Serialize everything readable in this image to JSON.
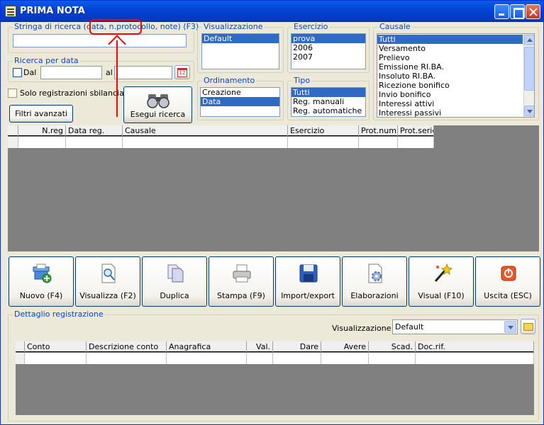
{
  "window": {
    "title": "PRIMA NOTA"
  },
  "search": {
    "legend": "Stringa di ricerca (data, n.protocollo, note) (F3)",
    "value": ""
  },
  "date_search": {
    "legend": "Ricerca per data",
    "from_label": "Dal",
    "to_label": "al",
    "from_value": "",
    "to_value": "",
    "calendar_day": "12"
  },
  "unbalanced_label": "Solo registrazioni sbilanciate",
  "advanced_filters_label": "Filtri avanzati",
  "run_search_label": "Esegui ricerca",
  "visualizzazione": {
    "legend": "Visualizzazione",
    "items": [
      {
        "label": "Default",
        "selected": true
      }
    ]
  },
  "esercizio": {
    "legend": "Esercizio",
    "items": [
      {
        "label": "prova",
        "selected": true
      },
      {
        "label": "2006",
        "selected": false
      },
      {
        "label": "2007",
        "selected": false
      }
    ]
  },
  "causale": {
    "legend": "Causale",
    "items": [
      {
        "label": "Tutti",
        "selected": true
      },
      {
        "label": "Versamento",
        "selected": false
      },
      {
        "label": "Prelievo",
        "selected": false
      },
      {
        "label": "Emissione RI.BA.",
        "selected": false
      },
      {
        "label": "Insoluto RI.BA.",
        "selected": false
      },
      {
        "label": "Ricezione bonifico",
        "selected": false
      },
      {
        "label": "Invio bonifico",
        "selected": false
      },
      {
        "label": "Interessi attivi",
        "selected": false
      },
      {
        "label": "Interessi passivi",
        "selected": false
      }
    ]
  },
  "ordinamento": {
    "legend": "Ordinamento",
    "items": [
      {
        "label": "Creazione",
        "selected": false
      },
      {
        "label": "Data",
        "selected": true
      }
    ]
  },
  "tipo": {
    "legend": "Tipo",
    "items": [
      {
        "label": "Tutti",
        "selected": true
      },
      {
        "label": "Reg. manuali",
        "selected": false
      },
      {
        "label": "Reg. automatiche",
        "selected": false
      }
    ]
  },
  "main_grid": {
    "columns": [
      "N.reg",
      "Data reg.",
      "Causale",
      "Esercizio",
      "Prot.num",
      "Prot.serie"
    ]
  },
  "actions": [
    {
      "label": "Nuovo (F4)",
      "icon": "new-document-icon"
    },
    {
      "label": "Visualizza (F2)",
      "icon": "view-document-icon"
    },
    {
      "label": "Duplica",
      "icon": "duplicate-icon"
    },
    {
      "label": "Stampa (F9)",
      "icon": "printer-icon"
    },
    {
      "label": "Import/export",
      "icon": "floppy-disk-icon"
    },
    {
      "label": "Elaborazioni",
      "icon": "process-gear-icon"
    },
    {
      "label": "Visual (F10)",
      "icon": "magic-wand-icon"
    },
    {
      "label": "Uscita (ESC)",
      "icon": "exit-icon"
    }
  ],
  "detail": {
    "legend": "Dettaglio registrazione",
    "view_label": "Visualizzazione :",
    "view_value": "Default",
    "columns": [
      "Conto",
      "Descrizione conto",
      "Anagrafica",
      "Val.",
      "Dare",
      "Avere",
      "Scad.",
      "Doc.rif."
    ]
  },
  "colors": {
    "title_bar": "#0542d6",
    "selection": "#316ac5",
    "legend_text": "#0046d5",
    "annotation": "#ff0000",
    "grid_background": "#808080"
  }
}
